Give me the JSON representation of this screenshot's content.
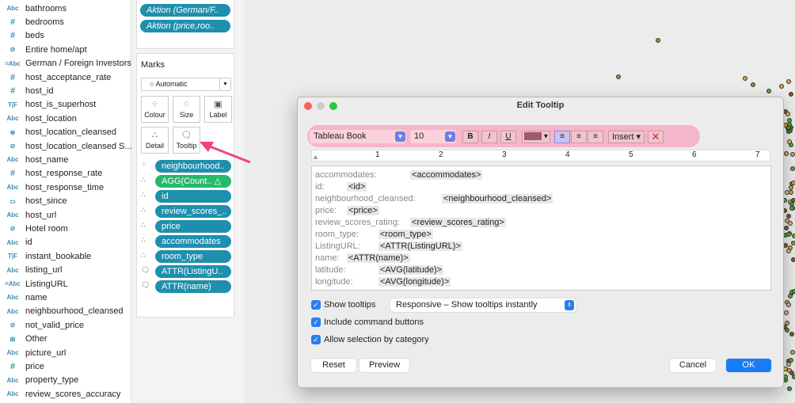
{
  "fields": [
    {
      "type": "Abc",
      "label": "bathrooms"
    },
    {
      "type": "#",
      "label": "bedrooms"
    },
    {
      "type": "#",
      "label": "beds"
    },
    {
      "type": "set",
      "label": "Entire home/apt"
    },
    {
      "type": "=Abc",
      "label": "German / Foreign Investors"
    },
    {
      "type": "#",
      "label": "host_acceptance_rate"
    },
    {
      "type": "#",
      "label": "host_id"
    },
    {
      "type": "T|F",
      "label": "host_is_superhost"
    },
    {
      "type": "Abc",
      "label": "host_location"
    },
    {
      "type": "geo",
      "label": "host_location_cleansed"
    },
    {
      "type": "set",
      "label": "host_location_cleansed S..."
    },
    {
      "type": "Abc",
      "label": "host_name"
    },
    {
      "type": "#",
      "label": "host_response_rate"
    },
    {
      "type": "Abc",
      "label": "host_response_time"
    },
    {
      "type": "date",
      "label": "host_since"
    },
    {
      "type": "Abc",
      "label": "host_url"
    },
    {
      "type": "set",
      "label": "Hotel room"
    },
    {
      "type": "Abc",
      "label": "id"
    },
    {
      "type": "T|F",
      "label": "instant_bookable"
    },
    {
      "type": "Abc",
      "label": "listing_url"
    },
    {
      "type": "=Abc",
      "label": "ListingURL"
    },
    {
      "type": "Abc",
      "label": "name"
    },
    {
      "type": "Abc",
      "label": "neighbourhood_cleansed"
    },
    {
      "type": "set",
      "label": "not_valid_price"
    },
    {
      "type": "group",
      "label": "Other"
    },
    {
      "type": "Abc",
      "label": "picture_url"
    },
    {
      "type": "#",
      "label": "price"
    },
    {
      "type": "Abc",
      "label": "property_type"
    },
    {
      "type": "Abc",
      "label": "review_scores_accuracy"
    }
  ],
  "filters": [
    "Aktion (German/F..",
    "Aktion (price,roo.."
  ],
  "marks": {
    "title": "Marks",
    "type": "Automatic",
    "buttons": [
      "Colour",
      "Size",
      "Label",
      "Detail",
      "Tooltip"
    ],
    "shelf": [
      {
        "icon": "colour",
        "label": "neighbourhood.."
      },
      {
        "icon": "detail",
        "label": "AGG(Count..  △",
        "green": true
      },
      {
        "icon": "detail",
        "label": "id"
      },
      {
        "icon": "detail",
        "label": "review_scores_.."
      },
      {
        "icon": "detail",
        "label": "price"
      },
      {
        "icon": "detail",
        "label": "accommodates"
      },
      {
        "icon": "detail",
        "label": "room_type"
      },
      {
        "icon": "tooltip",
        "label": "ATTR(ListingU.."
      },
      {
        "icon": "tooltip",
        "label": "ATTR(name)"
      }
    ]
  },
  "dialog": {
    "title": "Edit Tooltip",
    "font": "Tableau Book",
    "size": "10",
    "bold": "B",
    "italic": "I",
    "underline": "U",
    "insert": "Insert ▾",
    "ruler": [
      "1",
      "2",
      "3",
      "4",
      "5",
      "6",
      "7"
    ],
    "lines": [
      [
        "accommodates:",
        "<accommodates>"
      ],
      [
        "id:",
        "<id>"
      ],
      [
        "neighbourhood_cleansed:",
        "<neighbourhood_cleansed>"
      ],
      [
        "price:",
        "<price>"
      ],
      [
        "review_scores_rating:",
        "<review_scores_rating>"
      ],
      [
        "room_type:",
        "<room_type>"
      ],
      [
        "ListingURL:",
        "<ATTR(ListingURL)>"
      ],
      [
        "name:",
        "<ATTR(name)>"
      ],
      [
        "latitude:",
        "<AVG(latitude)>"
      ],
      [
        "longitude:",
        "<AVG(longitude)>"
      ]
    ],
    "show_tooltips": "Show tooltips",
    "tooltip_mode": "Responsive – Show tooltips instantly",
    "include_buttons": "Include command buttons",
    "allow_selection": "Allow selection by category",
    "reset": "Reset",
    "preview": "Preview",
    "cancel": "Cancel",
    "ok": "OK"
  },
  "colors": {
    "pill": "#1f8fae",
    "pill_green": "#27b86a",
    "highlight": "#f4b6c8",
    "arrow": "#f0457f",
    "ok": "#1a7cf5"
  }
}
